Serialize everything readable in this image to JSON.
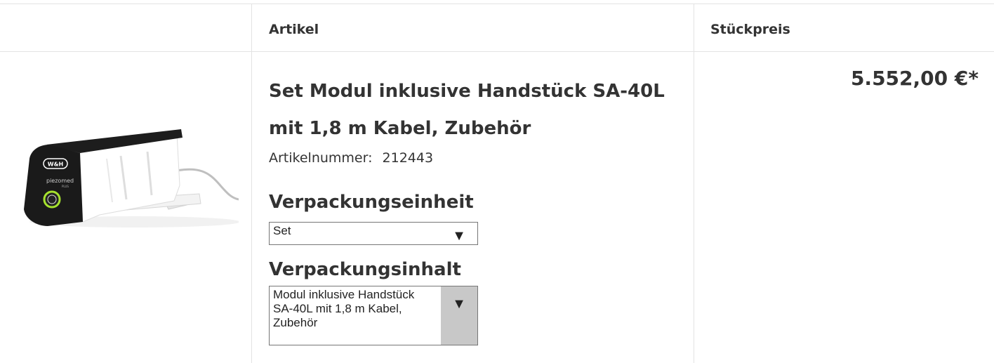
{
  "table_header": {
    "artikel": "Artikel",
    "stueckpreis": "Stückpreis"
  },
  "product": {
    "image_alt": "W&H piezomed plus module with handpiece",
    "image_brand": "W&H",
    "image_model": "piezomed",
    "image_sub": "PLUS",
    "title": "Set Modul inklusive Handstück SA-40L mit 1,8 m Kabel, Zubehör",
    "artikelnummer_label": "Artikelnummer:",
    "artikelnummer_value": "212443",
    "price": "5.552,00 €*"
  },
  "verpackungseinheit": {
    "heading": "Verpackungseinheit",
    "selected": "Set"
  },
  "verpackungsinhalt": {
    "heading": "Verpackungsinhalt",
    "selected_line1": "Modul inklusive Handstück",
    "selected_line2": "SA-40L mit 1,8 m Kabel,",
    "selected_line3": "Zubehör"
  },
  "icons": {
    "dropdown": "chevron-down-icon"
  }
}
